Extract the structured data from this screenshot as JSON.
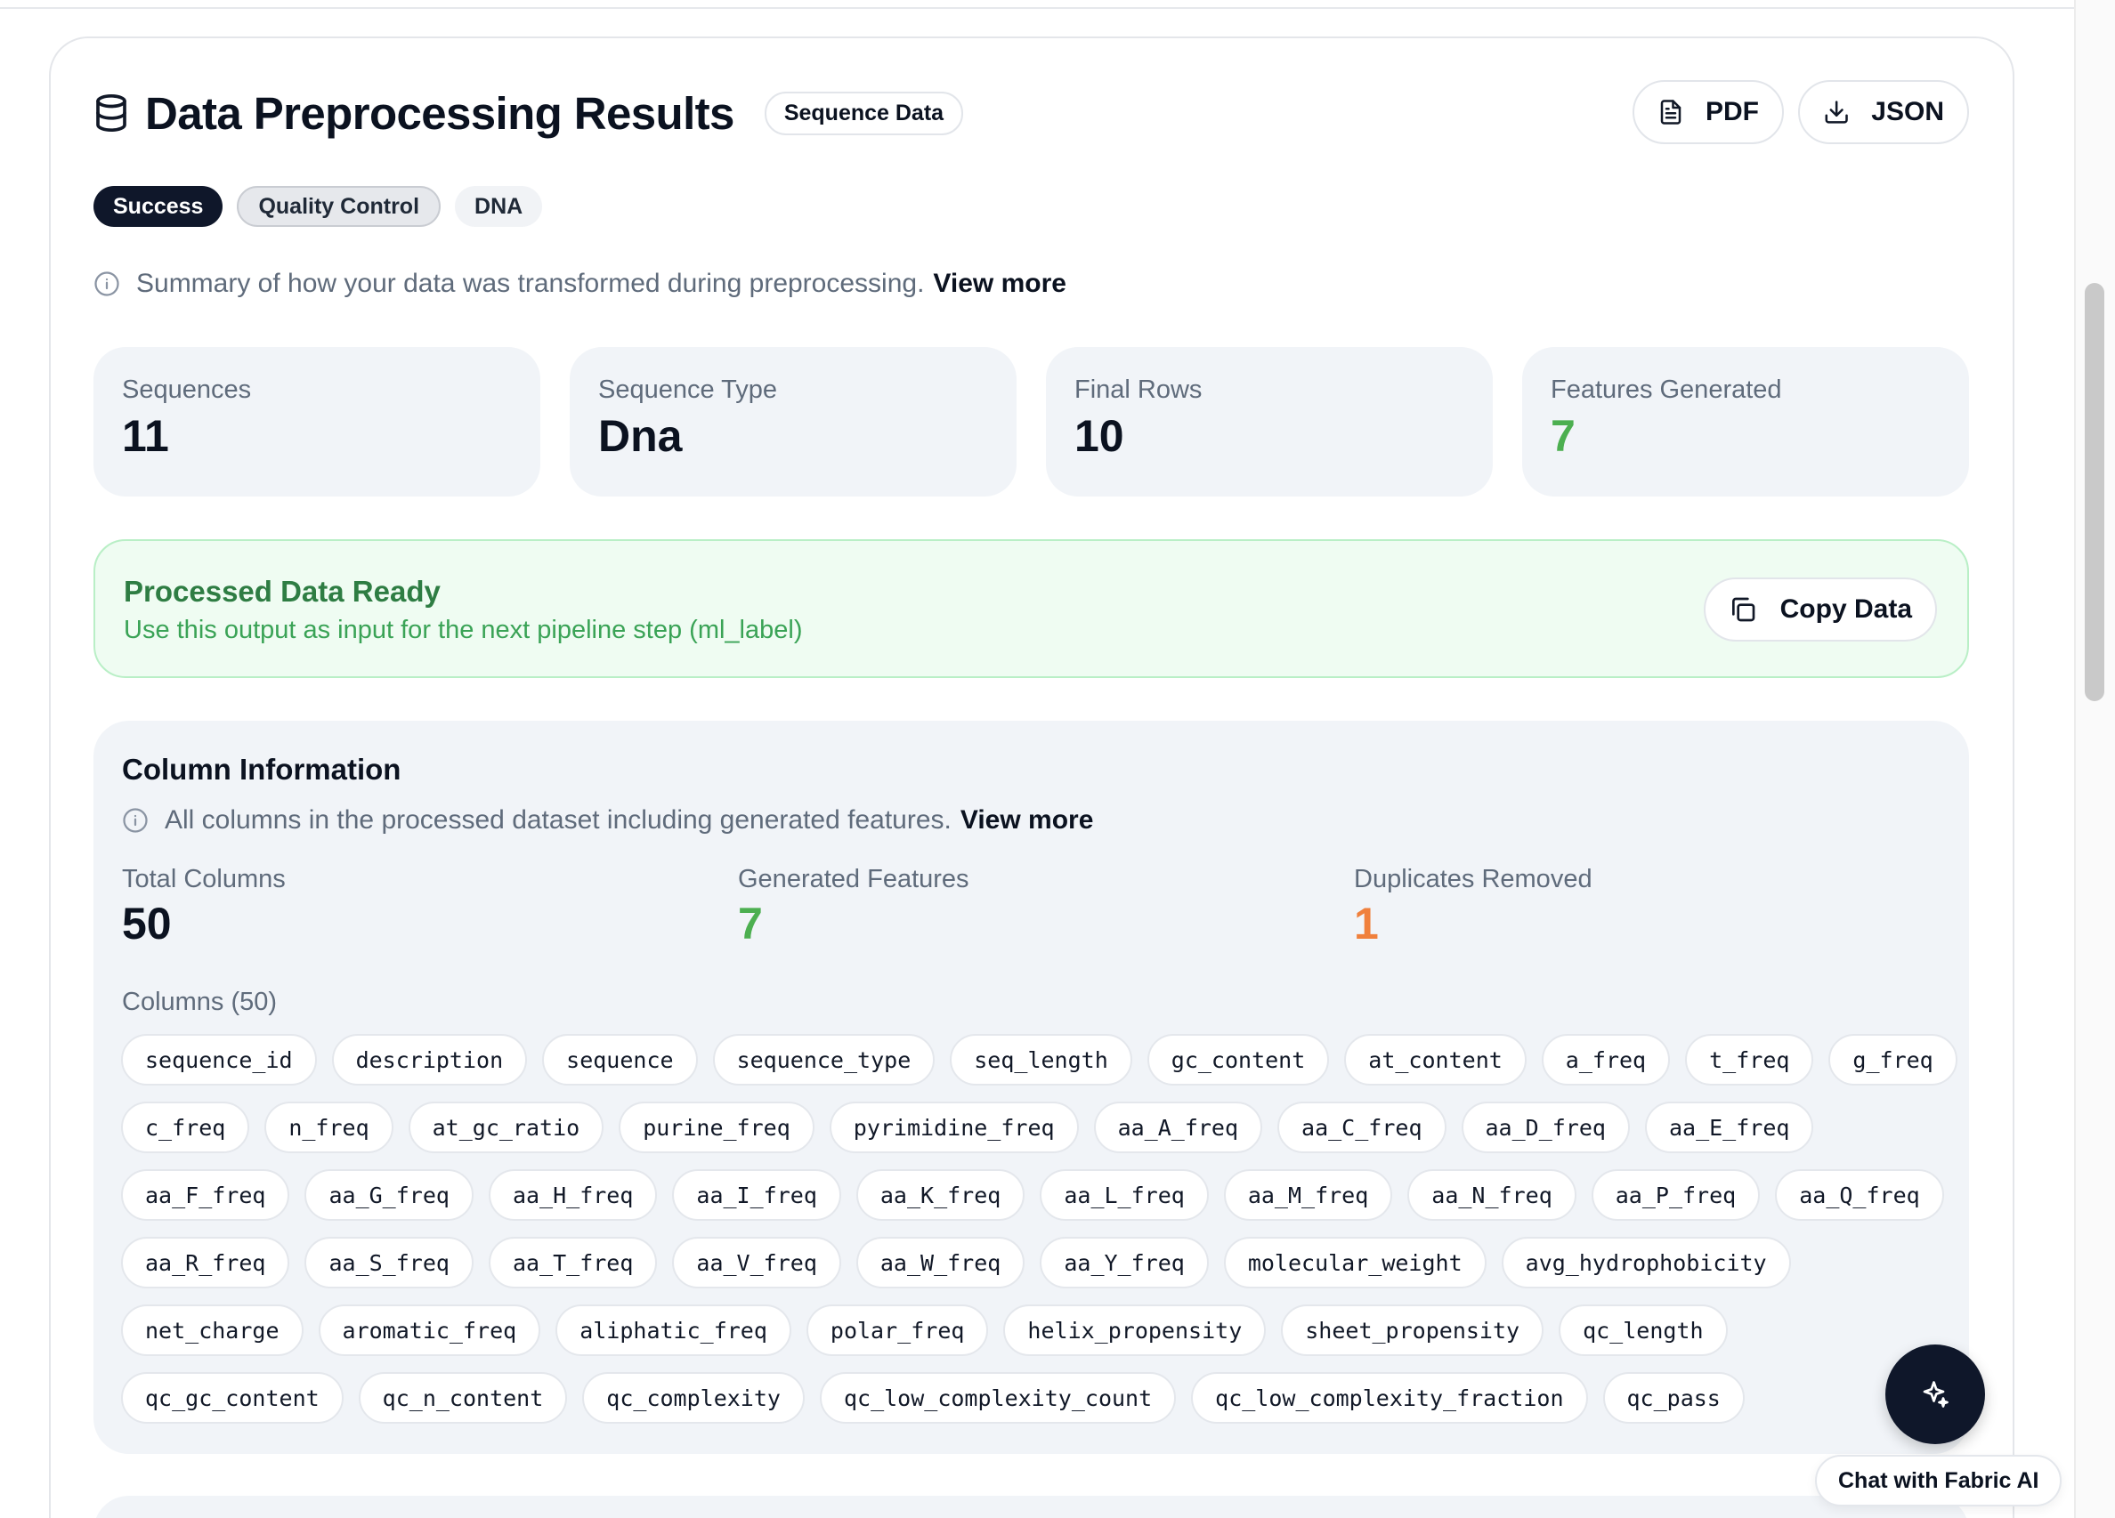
{
  "header": {
    "title": "Data Preprocessing Results",
    "tag": "Sequence Data",
    "pdf_label": "PDF",
    "json_label": "JSON"
  },
  "badges": [
    "Success",
    "Quality Control",
    "DNA"
  ],
  "summary": {
    "text": "Summary of how your data was transformed during preprocessing.",
    "more": "View more"
  },
  "stats": [
    {
      "label": "Sequences",
      "value": "11"
    },
    {
      "label": "Sequence Type",
      "value": "Dna"
    },
    {
      "label": "Final Rows",
      "value": "10"
    },
    {
      "label": "Features Generated",
      "value": "7"
    }
  ],
  "ready": {
    "title": "Processed Data Ready",
    "subtitle": "Use this output as input for the next pipeline step (ml_label)",
    "copy_label": "Copy Data"
  },
  "columns": {
    "title": "Column Information",
    "info": "All columns in the processed dataset including generated features.",
    "more": "View more",
    "total_label": "Total Columns",
    "total_value": "50",
    "generated_label": "Generated Features",
    "generated_value": "7",
    "dupes_label": "Duplicates Removed",
    "dupes_value": "1",
    "list_label": "Columns (50)",
    "names": [
      "sequence_id",
      "description",
      "sequence",
      "sequence_type",
      "seq_length",
      "gc_content",
      "at_content",
      "a_freq",
      "t_freq",
      "g_freq",
      "c_freq",
      "n_freq",
      "at_gc_ratio",
      "purine_freq",
      "pyrimidine_freq",
      "aa_A_freq",
      "aa_C_freq",
      "aa_D_freq",
      "aa_E_freq",
      "aa_F_freq",
      "aa_G_freq",
      "aa_H_freq",
      "aa_I_freq",
      "aa_K_freq",
      "aa_L_freq",
      "aa_M_freq",
      "aa_N_freq",
      "aa_P_freq",
      "aa_Q_freq",
      "aa_R_freq",
      "aa_S_freq",
      "aa_T_freq",
      "aa_V_freq",
      "aa_W_freq",
      "aa_Y_freq",
      "molecular_weight",
      "avg_hydrophobicity",
      "net_charge",
      "aromatic_freq",
      "aliphatic_freq",
      "polar_freq",
      "helix_propensity",
      "sheet_propensity",
      "qc_length",
      "qc_gc_content",
      "qc_n_content",
      "qc_complexity",
      "qc_low_complexity_count",
      "qc_low_complexity_fraction",
      "qc_pass"
    ]
  },
  "chat": {
    "label": "Chat with Fabric AI"
  },
  "colors": {
    "accent_dark": "#0f172a",
    "success_green": "#4caf50",
    "warning_orange": "#f0803c",
    "ready_bg": "#effcf2"
  }
}
